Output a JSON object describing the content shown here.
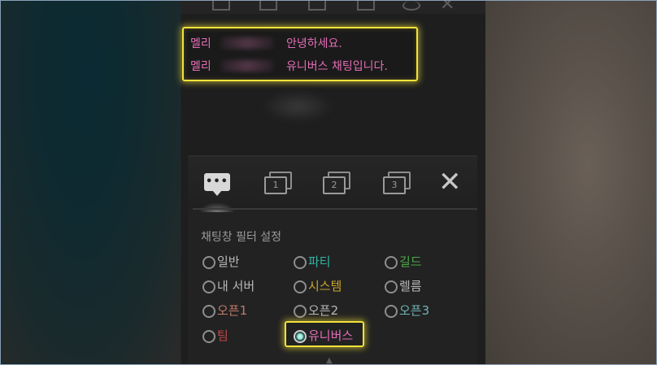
{
  "chat": {
    "lines": [
      {
        "name": "멜리",
        "message": "안녕하세요."
      },
      {
        "name": "멜리",
        "message": "유니버스 채팅입니다."
      }
    ]
  },
  "tabs": [
    {
      "id": "all",
      "icon": "chat-bubble-icon",
      "label": "•••"
    },
    {
      "id": "t1",
      "icon": "chat-tab-1-icon",
      "label": "1"
    },
    {
      "id": "t2",
      "icon": "chat-tab-2-icon",
      "label": "2"
    },
    {
      "id": "t3",
      "icon": "chat-tab-3-icon",
      "label": "3"
    }
  ],
  "filter": {
    "title": "채팅창 필터 설정",
    "options": [
      {
        "label": "일반",
        "color": "#b8b8b8",
        "checked": false
      },
      {
        "label": "파티",
        "color": "#2fb7a3",
        "checked": false
      },
      {
        "label": "길드",
        "color": "#4aa84a",
        "checked": false
      },
      {
        "label": "내 서버",
        "color": "#b8b8b8",
        "checked": false
      },
      {
        "label": "시스템",
        "color": "#c7a42f",
        "checked": false
      },
      {
        "label": "렐름",
        "color": "#b8b8b8",
        "checked": false
      },
      {
        "label": "오픈1",
        "color": "#c07a6a",
        "checked": false
      },
      {
        "label": "오픈2",
        "color": "#b8b8b8",
        "checked": false
      },
      {
        "label": "오픈3",
        "color": "#6fb4b4",
        "checked": false
      },
      {
        "label": "팀",
        "color": "#c24646",
        "checked": false
      },
      {
        "label": "유니버스",
        "color": "#e36db6",
        "checked": true
      }
    ]
  },
  "colors": {
    "highlight": "#f3e23a",
    "universe": "#e36db6"
  }
}
